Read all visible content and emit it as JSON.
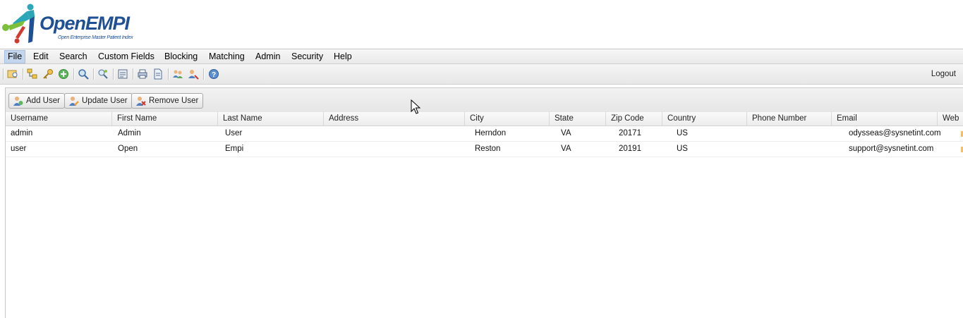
{
  "app": {
    "logo_title": "OpenEMPI",
    "logo_subtitle": "Open Enterprise Master Patient Index"
  },
  "menu": {
    "items": [
      "File",
      "Edit",
      "Search",
      "Custom Fields",
      "Blocking",
      "Matching",
      "Admin",
      "Security",
      "Help"
    ],
    "active": "File"
  },
  "toolbar": {
    "icons": [
      "search-record-icon",
      "hierarchy-icon",
      "key-icon",
      "add-icon",
      "zoom-icon",
      "link-icon",
      "report-icon",
      "print-icon",
      "document-icon",
      "users-icon",
      "user-edit-icon",
      "help-icon"
    ],
    "logout_label": "Logout"
  },
  "buttons": {
    "add_user": "Add User",
    "update_user": "Update User",
    "remove_user": "Remove User"
  },
  "table": {
    "columns": [
      "Username",
      "First Name",
      "Last Name",
      "Address",
      "City",
      "State",
      "Zip Code",
      "Country",
      "Phone Number",
      "Email",
      "Web"
    ],
    "rows": [
      {
        "username": "admin",
        "first_name": "Admin",
        "last_name": "User",
        "address": "",
        "city": "Herndon",
        "state": "VA",
        "zip": "20171",
        "country": "US",
        "phone": "",
        "email": "odysseas@sysnetint.com"
      },
      {
        "username": "user",
        "first_name": "Open",
        "last_name": "Empi",
        "address": "",
        "city": "Reston",
        "state": "VA",
        "zip": "20191",
        "country": "US",
        "phone": "",
        "email": "support@sysnetint.com"
      }
    ]
  },
  "colors": {
    "logo_blue": "#1f4f95",
    "logo_teal": "#2aa6b8",
    "logo_green": "#7cbf3a",
    "logo_red": "#d23a2e",
    "menu_active": "#c4d6ee"
  }
}
